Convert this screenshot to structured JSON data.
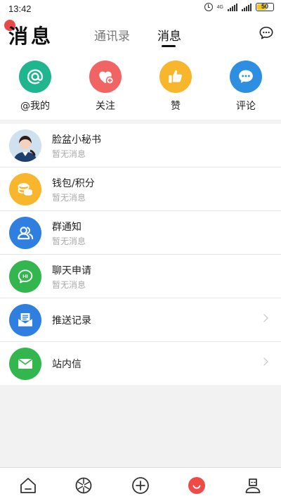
{
  "status_bar": {
    "time": "13:42",
    "network": "4G",
    "battery": "50"
  },
  "header": {
    "title": "消息",
    "tabs": [
      {
        "label": "通讯录"
      },
      {
        "label": "消息"
      }
    ]
  },
  "quick_actions": [
    {
      "label": "@我的",
      "icon": "at-icon",
      "color": "#1fb58f"
    },
    {
      "label": "关注",
      "icon": "heart-plus-icon",
      "color": "#f06463"
    },
    {
      "label": "赞",
      "icon": "thumbs-up-icon",
      "color": "#f7b62b"
    },
    {
      "label": "评论",
      "icon": "comment-icon",
      "color": "#2e8ee0"
    }
  ],
  "messages": [
    {
      "title": "脸盆小秘书",
      "subtitle": "暂无消息",
      "icon": "avatar"
    },
    {
      "title": "钱包/积分",
      "subtitle": "暂无消息",
      "icon": "coins-icon",
      "color": "#f7b62b"
    },
    {
      "title": "群通知",
      "subtitle": "暂无消息",
      "icon": "group-icon",
      "color": "#2e7fe0"
    },
    {
      "title": "聊天申请",
      "subtitle": "暂无消息",
      "icon": "hi-bubble-icon",
      "color": "#34b64f"
    },
    {
      "title": "推送记录",
      "icon": "inbox-icon",
      "color": "#2e7fe0"
    },
    {
      "title": "站内信",
      "icon": "envelope-icon",
      "color": "#34b64f"
    }
  ],
  "bottom_nav": [
    {
      "icon": "home-icon"
    },
    {
      "icon": "discover-icon"
    },
    {
      "icon": "add-icon"
    },
    {
      "icon": "messages-icon",
      "active_color": "#f04a46"
    },
    {
      "icon": "profile-icon"
    }
  ]
}
